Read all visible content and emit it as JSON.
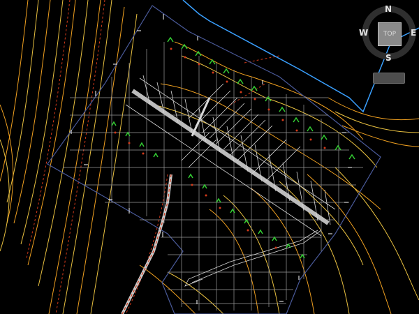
{
  "viewcube": {
    "north": "N",
    "south": "S",
    "east": "E",
    "west": "W",
    "face": "TOP"
  },
  "wcs_menu": {
    "label": ""
  },
  "colors": {
    "background": "#000000",
    "contour_major": "#f0a020",
    "contour_minor": "#e8c040",
    "contour_red": "#d23a1a",
    "boundary_blue": "#3aa0ff",
    "boundary_slate": "#4a5a9a",
    "grid_gray": "#9a9a9a",
    "vegetation_green": "#33cc33",
    "hatch_white": "#d8d8d8"
  }
}
